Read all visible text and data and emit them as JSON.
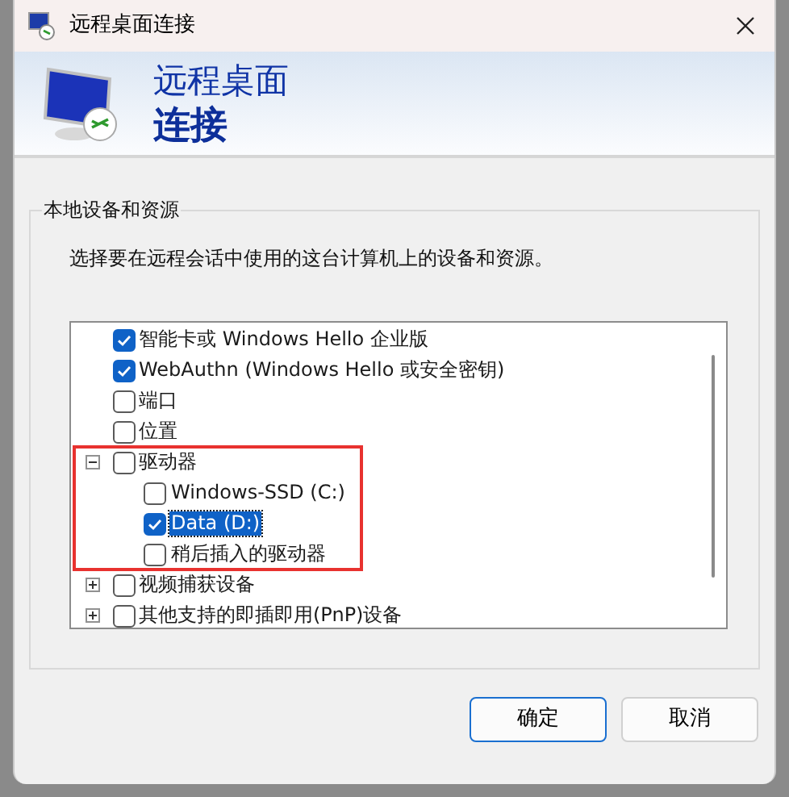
{
  "window": {
    "title": "远程桌面连接"
  },
  "banner": {
    "line1": "远程桌面",
    "line2": "连接"
  },
  "group": {
    "title": "本地设备和资源",
    "description": "选择要在远程会话中使用的这台计算机上的设备和资源。"
  },
  "tree": [
    {
      "label": "智能卡或 Windows Hello 企业版",
      "checked": true
    },
    {
      "label": "WebAuthn (Windows Hello 或安全密钥)",
      "checked": true
    },
    {
      "label": "端口",
      "checked": false
    },
    {
      "label": "位置",
      "checked": false
    },
    {
      "label": "驱动器",
      "checked": false,
      "expanded": true,
      "highlighted": true,
      "children": [
        {
          "label": "Windows-SSD (C:)",
          "checked": false,
          "selected": false
        },
        {
          "label": "Data (D:)",
          "checked": true,
          "selected": true
        },
        {
          "label": "稍后插入的驱动器",
          "checked": false,
          "selected": false
        }
      ]
    },
    {
      "label": "视频捕获设备",
      "checked": false,
      "expanded": false
    },
    {
      "label": "其他支持的即插即用(PnP)设备",
      "checked": false,
      "expanded": false
    }
  ],
  "buttons": [
    {
      "label": "确定",
      "default": true
    },
    {
      "label": "取消",
      "default": false
    }
  ]
}
